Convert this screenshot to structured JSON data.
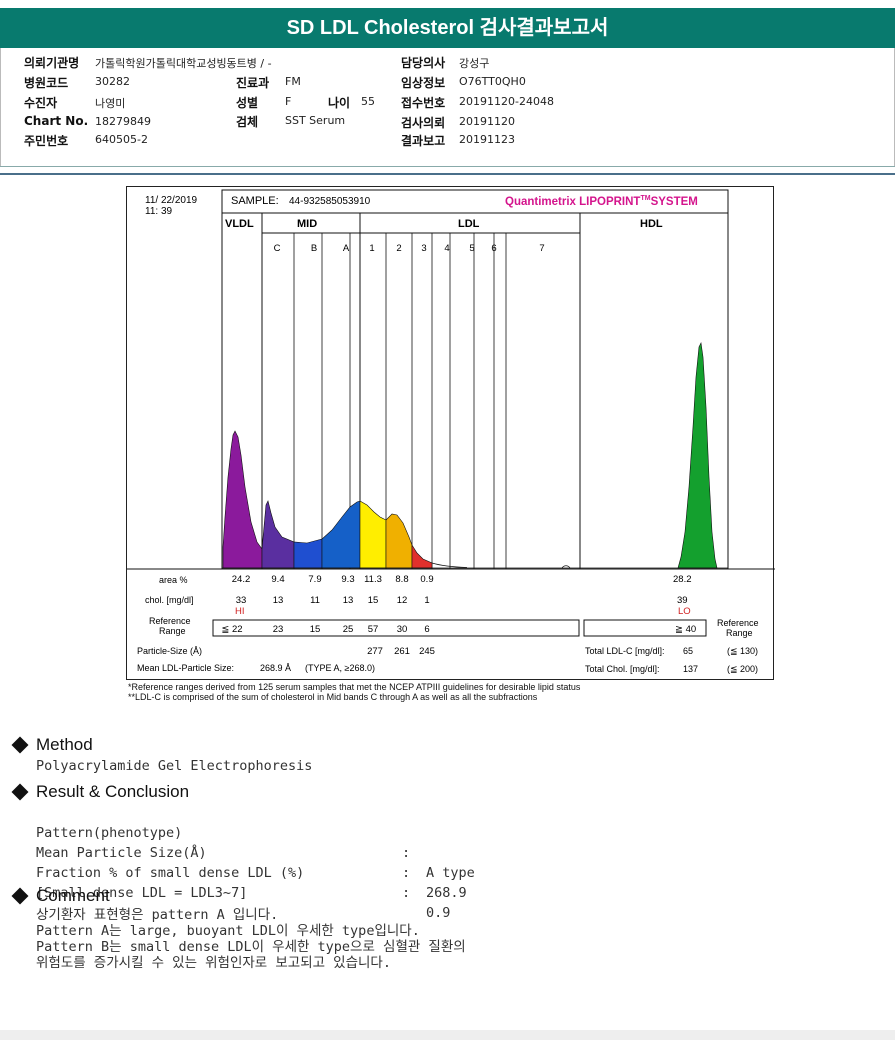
{
  "title": "SD LDL Cholesterol 검사결과보고서",
  "patient": {
    "institution_label": "의뢰기관명",
    "institution": "가톨릭학원가톨릭대학교성빙동트병 / -",
    "hospital_code_label": "병원코드",
    "hospital_code": "30282",
    "patient_name_label": "수진자",
    "patient_name": "나영미",
    "chart_no_label": "Chart No.",
    "chart_no": "18279849",
    "resident_no_label": "주민번호",
    "resident_no": "640505-2",
    "department_label": "진료과",
    "department": "FM",
    "sex_label": "성별",
    "sex": "F",
    "age_label": "나이",
    "age": "55",
    "specimen_label": "검체",
    "specimen": "SST Serum",
    "doctor_label": "담당의사",
    "doctor": "강성구",
    "clinical_info_label": "임상정보",
    "clinical_info": "O76TT0QH0",
    "receipt_no_label": "접수번호",
    "receipt_no": "20191120-24048",
    "request_date_label": "검사의뢰",
    "request_date": "20191120",
    "report_date_label": "결과보고",
    "report_date": "20191123"
  },
  "chart_data": {
    "type": "area",
    "date": "11/ 22/2019",
    "time": "11: 39",
    "sample_label": "SAMPLE:",
    "sample_id": "44-932585053910",
    "brand": "Quantimetrix LIPOPRINT",
    "brand_tm": "TM",
    "brand_suffix": "SYSTEM",
    "groups": [
      "VLDL",
      "MID",
      "LDL",
      "HDL"
    ],
    "bands": [
      "C",
      "B",
      "A",
      "1",
      "2",
      "3",
      "4",
      "5",
      "6",
      "7"
    ],
    "series": [
      {
        "name": "VLDL",
        "color": "#8b1a9c"
      },
      {
        "name": "MID C",
        "color": "#5a2fa0"
      },
      {
        "name": "MID B",
        "color": "#1f4fd0"
      },
      {
        "name": "MID A",
        "color": "#1560c8"
      },
      {
        "name": "LDL 1",
        "color": "#ffee00"
      },
      {
        "name": "LDL 2",
        "color": "#f0b000"
      },
      {
        "name": "LDL 3",
        "color": "#e0302c"
      },
      {
        "name": "HDL",
        "color": "#14a02e"
      }
    ],
    "rows": {
      "area_label": "area %",
      "area": [
        "24.2",
        "9.4",
        "7.9",
        "9.3",
        "11.3",
        "8.8",
        "0.9"
      ],
      "area_hdl": "28.2",
      "chol_label": "chol. [mg/dl]",
      "chol": [
        "33",
        "13",
        "11",
        "13",
        "15",
        "12",
        "1"
      ],
      "chol_hdl": "39",
      "hi_flag": "HI",
      "lo_flag": "LO",
      "ref_label_1": "Reference",
      "ref_label_2": "Range",
      "ref": [
        "≦ 22",
        "23",
        "15",
        "25",
        "57",
        "30",
        "6"
      ],
      "ref_hdl": "≧ 40",
      "ref_right_1": "Reference",
      "ref_right_2": "Range",
      "particle_label": "Particle-Size (Å)",
      "particle": [
        "277",
        "261",
        "245"
      ],
      "mean_label": "Mean LDL-Particle Size:",
      "mean_value": "268.9 Å",
      "mean_type": "(TYPE A, ≥268.0)",
      "total_ldl_label": "Total LDL-C [mg/dl]:",
      "total_ldl": "65",
      "total_ldl_ref": "(≦ 130)",
      "total_chol_label": "Total Chol. [mg/dl]:",
      "total_chol": "137",
      "total_chol_ref": "(≦ 200)"
    }
  },
  "footnotes": [
    "*Reference ranges derived from 125 serum samples that met the NCEP ATPIII guidelines for desirable lipid status",
    "**LDL-C is comprised of the sum of cholesterol in Mid bands C through A as well as all the subfractions"
  ],
  "method": {
    "heading": "Method",
    "text": "Polyacrylamide Gel Electrophoresis"
  },
  "result": {
    "heading": "Result & Conclusion",
    "items": [
      {
        "label": "Pattern(phenotype)",
        "value": "A type"
      },
      {
        "label": "Mean Particle Size(Å)",
        "value": "268.9"
      },
      {
        "label": "Fraction % of small dense LDL (%)",
        "value": "0.9"
      }
    ],
    "note": "[Small dense LDL = LDL3~7]"
  },
  "comment": {
    "heading": "Comment",
    "lines": [
      "상기환자 표현형은 pattern A 입니다.",
      "Pattern A는 large, buoyant LDL이 우세한 type입니다.",
      "Pattern B는 small dense LDL이 우세한 type으로 심혈관 질환의",
      "위험도를 증가시킬 수 있는 위험인자로 보고되고 있습니다."
    ]
  }
}
